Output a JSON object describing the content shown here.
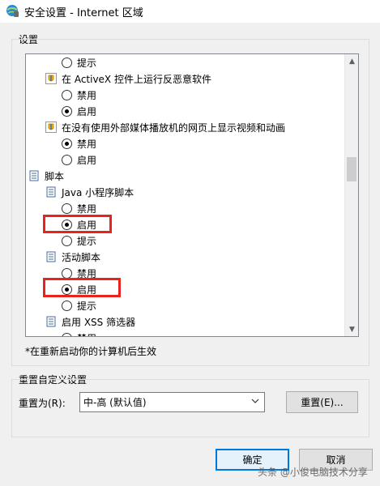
{
  "window": {
    "title": "安全设置 - Internet 区域"
  },
  "settings_group": {
    "label": "设置"
  },
  "settings_list": {
    "items": [
      {
        "kind": "radio",
        "label": "提示",
        "checked": false
      },
      {
        "kind": "setting",
        "label": "在 ActiveX 控件上运行反恶意软件"
      },
      {
        "kind": "radio",
        "label": "禁用",
        "checked": false
      },
      {
        "kind": "radio",
        "label": "启用",
        "checked": true
      },
      {
        "kind": "setting",
        "label": "在没有使用外部媒体播放机的网页上显示视频和动画"
      },
      {
        "kind": "radio",
        "label": "禁用",
        "checked": true
      },
      {
        "kind": "radio",
        "label": "启用",
        "checked": false
      },
      {
        "kind": "category",
        "label": "脚本"
      },
      {
        "kind": "subcategory",
        "label": "Java 小程序脚本"
      },
      {
        "kind": "radio",
        "label": "禁用",
        "checked": false
      },
      {
        "kind": "radio",
        "label": "启用",
        "checked": true
      },
      {
        "kind": "radio",
        "label": "提示",
        "checked": false
      },
      {
        "kind": "subcategory",
        "label": "活动脚本"
      },
      {
        "kind": "radio",
        "label": "禁用",
        "checked": false
      },
      {
        "kind": "radio",
        "label": "启用",
        "checked": true
      },
      {
        "kind": "radio",
        "label": "提示",
        "checked": false
      },
      {
        "kind": "subcategory",
        "label": "启用 XSS 筛选器"
      },
      {
        "kind": "radio",
        "label": "禁用",
        "checked": false
      }
    ]
  },
  "restart_note": "*在重新启动你的计算机后生效",
  "reset_group": {
    "label": "重置自定义设置",
    "reset_to_label": "重置为(R):",
    "reset_level_value": "中-高 (默认值)",
    "reset_button": "重置(E)..."
  },
  "footer": {
    "ok_button": "确定",
    "cancel_button": "取消"
  },
  "watermark": "头条 @小俊电脑技术分享",
  "colors": {
    "highlight_box": "#e8231c",
    "window_bg": "#f0f0f0",
    "primary_button_border": "#0078d7"
  }
}
